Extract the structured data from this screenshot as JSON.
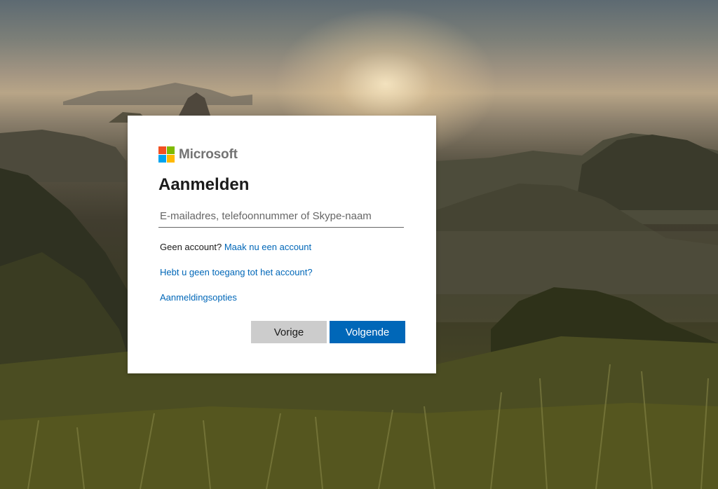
{
  "brand": {
    "name": "Microsoft",
    "colors": [
      "#f25022",
      "#7fba00",
      "#00a4ef",
      "#ffb900"
    ]
  },
  "signin": {
    "title": "Aanmelden",
    "email_placeholder": "E-mailadres, telefoonnummer of Skype-naam",
    "email_value": "",
    "no_account_text": "Geen account?",
    "create_account_link": "Maak nu een account",
    "no_access_link": "Hebt u geen toegang tot het account?",
    "signin_options_link": "Aanmeldingsopties",
    "back_button": "Vorige",
    "next_button": "Volgende"
  },
  "theme": {
    "accent": "#0067b8",
    "secondary_button": "#cccccc"
  }
}
